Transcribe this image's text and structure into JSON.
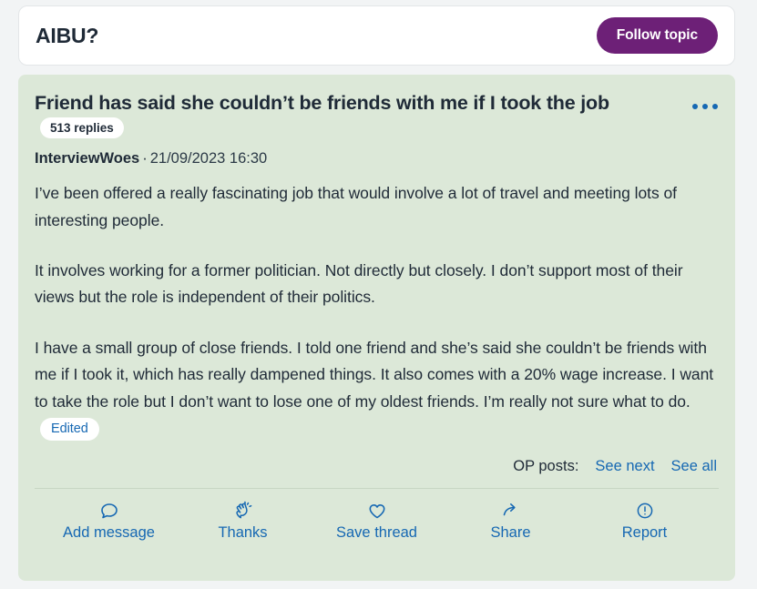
{
  "topic_header": {
    "title": "AIBU?",
    "follow_button": "Follow topic"
  },
  "post": {
    "title": "Friend has said she couldn’t be friends with me if I took the job",
    "replies_badge": "513 replies",
    "menu_icon": "kebab-menu-icon",
    "author": "InterviewWoes",
    "separator": "·",
    "timestamp": "21/09/2023 16:30",
    "paragraphs": [
      "I’ve been offered a really fascinating job that would involve a lot of travel and meeting lots of interesting people.",
      "It involves working for a former politician. Not directly but closely. I don’t support most of their views but the role is independent of their politics.",
      "I have a small group of close friends. I told one friend and she’s said she couldn’t be friends with me if I took it, which has really dampened things. It also comes with a 20% wage increase. I want to take the role but I don’t want to lose one of my oldest friends. I’m really not sure what to do."
    ],
    "edited_badge": "Edited"
  },
  "op_posts": {
    "label": "OP posts:",
    "see_next": "See next",
    "see_all": "See all"
  },
  "actions": [
    {
      "label": "Add message",
      "icon": "speech-bubble-icon"
    },
    {
      "label": "Thanks",
      "icon": "clapping-hands-icon"
    },
    {
      "label": "Save thread",
      "icon": "heart-icon"
    },
    {
      "label": "Share",
      "icon": "share-arrow-icon"
    },
    {
      "label": "Report",
      "icon": "exclamation-circle-icon"
    }
  ],
  "colors": {
    "page_background": "#f2f4f5",
    "post_background": "#dce8d8",
    "brand_purple": "#6d2077",
    "link_blue": "#1668b3",
    "text_dark": "#1f2a37"
  }
}
